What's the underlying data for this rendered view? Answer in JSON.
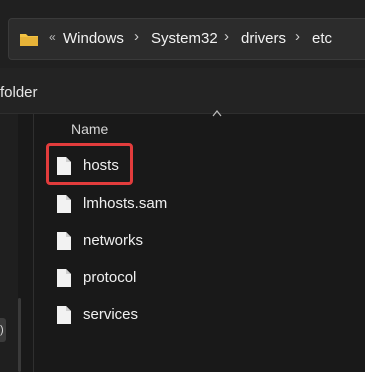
{
  "address": {
    "more_chevrons": "«",
    "breadcrumbs": [
      "Windows",
      "System32",
      "drivers",
      "etc"
    ],
    "separator": "›"
  },
  "toolbar": {
    "partial_label": "folder"
  },
  "sidebar": {
    "chip_text": ")"
  },
  "list": {
    "column_header": "Name",
    "files": [
      {
        "name": "hosts",
        "highlighted": true
      },
      {
        "name": "lmhosts.sam",
        "highlighted": false
      },
      {
        "name": "networks",
        "highlighted": false
      },
      {
        "name": "protocol",
        "highlighted": false
      },
      {
        "name": "services",
        "highlighted": false
      }
    ]
  },
  "colors": {
    "highlight_border": "#e23c3c",
    "folder_yellow": "#f3c343",
    "background": "#191919"
  },
  "icons": {
    "folder": "folder-icon",
    "file": "file-icon",
    "sort": "sort-up-icon"
  }
}
